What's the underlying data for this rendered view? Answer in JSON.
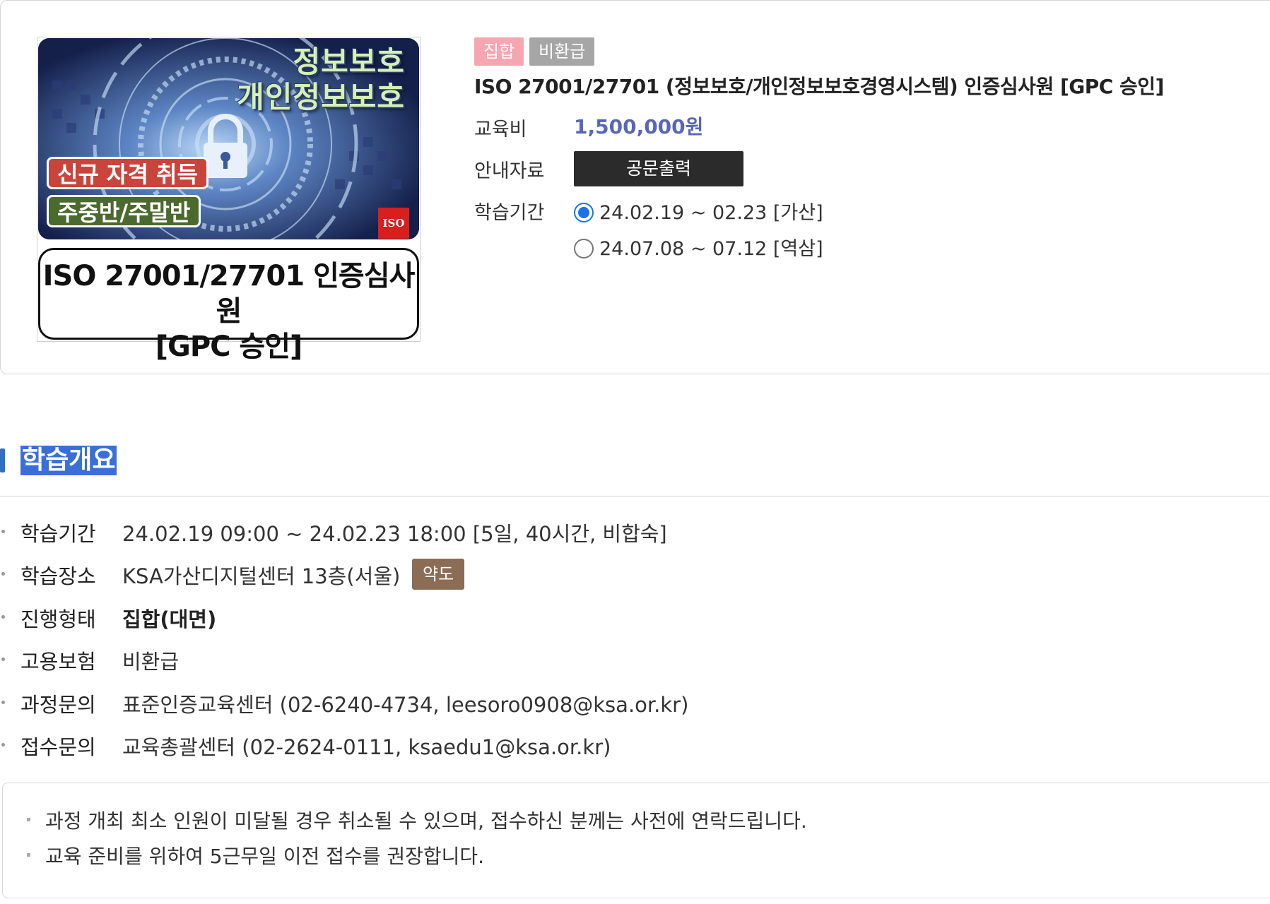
{
  "course": {
    "badges": [
      "집합",
      "비환급"
    ],
    "title": "ISO 27001/27701 (정보보호/개인정보보호경영시스템) 인증심사원 [GPC 승인]",
    "fee_label": "교육비",
    "fee_value": "1,500,000원",
    "guide_label": "안내자료",
    "print_button": "공문출력",
    "period_label": "학습기간",
    "period_options": [
      {
        "label": "24.02.19 ~ 02.23 [가산]",
        "selected": true
      },
      {
        "label": "24.07.08 ~ 07.12 [역삼]",
        "selected": false
      }
    ]
  },
  "thumbnail": {
    "heading1": "정보보호",
    "heading2": "개인정보보호",
    "pill_new": "신규 자격 취득",
    "pill_schedule": "주중반/주말반",
    "logo_text": "ISO",
    "caption_line1": "ISO 27001/27701 인증심사원",
    "caption_line2": "[GPC 승인]"
  },
  "overview": {
    "section_title": "학습개요",
    "rows": [
      {
        "key": "학습기간",
        "value": "24.02.19 09:00 ~ 24.02.23 18:00 [5일, 40시간, 비합숙]"
      },
      {
        "key": "학습장소",
        "value": "KSA가산디지털센터 13층(서울)"
      },
      {
        "key": "진행형태",
        "value": "집합(대면)"
      },
      {
        "key": "고용보험",
        "value": "비환급"
      },
      {
        "key": "과정문의",
        "value": "표준인증교육센터 (02-6240-4734, leesoro0908@ksa.or.kr)"
      },
      {
        "key": "접수문의",
        "value": "교육총괄센터 (02-2624-0111, ksaedu1@ksa.or.kr)"
      }
    ],
    "map_button": "약도"
  },
  "notices": [
    "과정 개최 최소 인원이 미달될 경우 취소될 수 있으며, 접수하신 분께는 사전에 연락드립니다.",
    "교육 준비를 위하여 5근무일 이전 접수를 권장합니다."
  ],
  "colors": {
    "fee": "#5866b8",
    "badge_group": "#f5a6b0",
    "badge_refund": "#a6a6a6",
    "section_accent": "#2f6fc4",
    "map_chip": "#8b6d55"
  }
}
